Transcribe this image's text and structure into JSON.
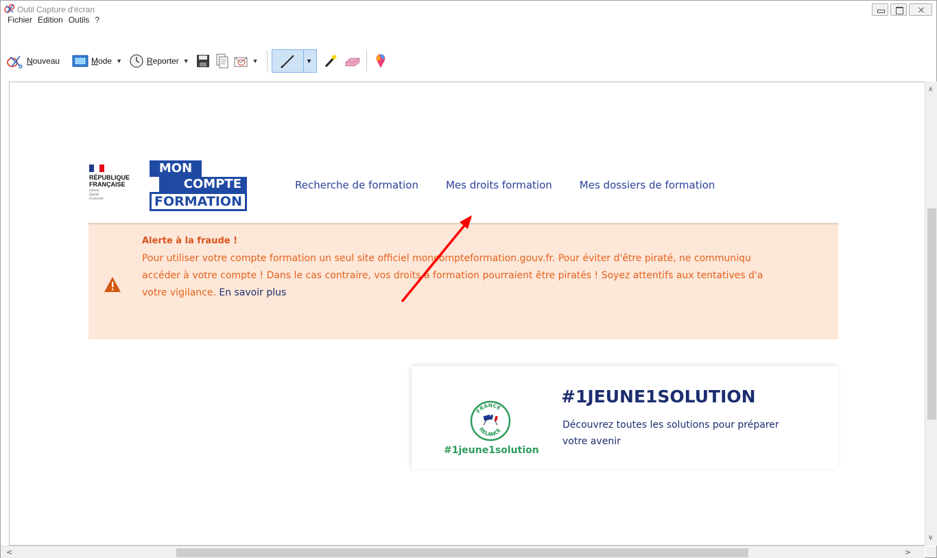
{
  "window": {
    "title": "Outil Capture d'écran"
  },
  "menu": [
    "Fichier",
    "Edition",
    "Outils",
    "?"
  ],
  "toolbar": {
    "new_label": "Nouveau",
    "new_accesskey": "N",
    "mode_label": "Mode",
    "mode_accesskey": "M",
    "delay_label": "Reporter",
    "delay_accesskey": "R",
    "icons": [
      "snip-icon",
      "mode-icon",
      "clock-icon",
      "save-icon",
      "copy-icon",
      "send-email-icon",
      "pen-icon",
      "highlighter-icon",
      "eraser-icon",
      "paint3d-icon"
    ]
  },
  "page": {
    "gov": {
      "line1": "RÉPUBLIQUE",
      "line2": "FRANÇAISE",
      "motto1": "Liberté",
      "motto2": "Égalité",
      "motto3": "Fraternité"
    },
    "brand": {
      "mon": "MON",
      "compte": "COMPTE",
      "formation": "FORMATION"
    },
    "nav": [
      "Recherche de formation",
      "Mes droits formation",
      "Mes dossiers de formation"
    ],
    "alert": {
      "title": "Alerte à la fraude !",
      "line1": "Pour utiliser votre compte formation un seul site officiel moncompteformation.gouv.fr. Pour éviter d'être piraté, ne communiqu",
      "line2": "accéder à votre compte ! Dans le cas contraire, vos droits à formation pourraient être piratés ! Soyez attentifs aux tentatives d'a",
      "line3": "votre vigilance.",
      "link": "En savoir plus"
    },
    "card": {
      "badge_top": "FRANCE",
      "badge_bottom": "RELANCE",
      "hashtag": "#1jeune1solution",
      "title": "#1JEUNE1SOLUTION",
      "desc_line1": "Découvrez toutes les solutions pour préparer",
      "desc_line2": "votre avenir"
    }
  },
  "colors": {
    "brand_blue": "#1f4aa3",
    "nav_blue": "#2a3f9a",
    "alert_bg": "#fde7d8",
    "alert_text": "#e4621e",
    "green": "#2d9b5a",
    "arrow_red": "#ff0000"
  }
}
